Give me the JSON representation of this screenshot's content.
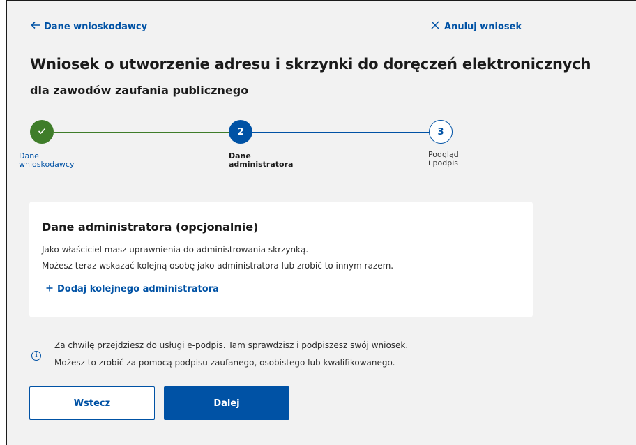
{
  "nav": {
    "back_label": "Dane wnioskodawcy",
    "cancel_label": "Anuluj wniosek"
  },
  "header": {
    "title": "Wniosek o utworzenie adresu i skrzynki do doręczeń elektronicznych",
    "subtitle": "dla zawodów zaufania publicznego"
  },
  "stepper": {
    "steps": [
      {
        "number": "",
        "label_line1": "Dane",
        "label_line2": "wnioskodawcy",
        "state": "completed"
      },
      {
        "number": "2",
        "label_line1": "Dane",
        "label_line2": "administratora",
        "state": "current"
      },
      {
        "number": "3",
        "label_line1": "Podgląd",
        "label_line2": "i podpis",
        "state": "upcoming"
      }
    ]
  },
  "card": {
    "title": "Dane administratora (opcjonalnie)",
    "line1": "Jako właściciel masz uprawnienia do administrowania skrzynką.",
    "line2": "Możesz teraz wskazać kolejną osobę jako administratora lub zrobić to innym razem.",
    "add_label": "Dodaj kolejnego administratora"
  },
  "info": {
    "line1": "Za chwilę przejdziesz do usługi e-podpis. Tam sprawdzisz i podpiszesz swój wniosek.",
    "line2": "Możesz to zrobić za pomocą podpisu zaufanego, osobistego lub kwalifikowanego."
  },
  "buttons": {
    "back_label": "Wstecz",
    "next_label": "Dalej"
  },
  "colors": {
    "primary": "#0052a5",
    "completed": "#3f7d2a",
    "background": "#f2f2f2"
  }
}
